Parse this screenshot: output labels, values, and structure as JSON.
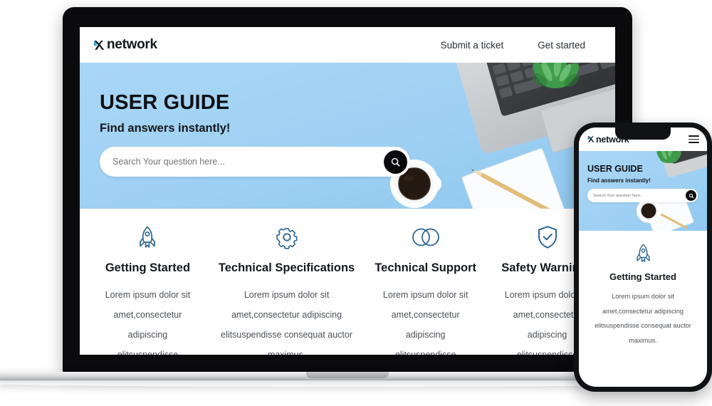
{
  "brand": {
    "name": "network",
    "mark_icon": "x-logo-icon",
    "accent_color": "#3aa0dd",
    "text_color": "#15181c"
  },
  "nav": {
    "links": [
      {
        "label": "Submit a ticket"
      },
      {
        "label": "Get started"
      }
    ],
    "mobile_menu_icon": "hamburger-menu-icon"
  },
  "hero": {
    "title": "USER GUIDE",
    "subtitle": "Find answers instantly!",
    "background_color": "#9ed0f3",
    "search": {
      "placeholder": "Search Your question here...",
      "value": "",
      "button_icon": "search-icon",
      "button_color": "#0b0b0d"
    }
  },
  "cards": [
    {
      "icon": "rocket-icon",
      "title": "Getting Started",
      "body": "Lorem ipsum dolor sit amet,consectetur adipiscing elitsuspendisse consequat auctor maximus."
    },
    {
      "icon": "gear-icon",
      "title": "Technical Specifications",
      "body": "Lorem ipsum dolor sit amet,consectetur adipiscing elitsuspendisse consequat auctor maximus."
    },
    {
      "icon": "venn-circles-icon",
      "title": "Technical Support",
      "body": "Lorem ipsum dolor sit amet,consectetur adipiscing elitsuspendisse consequat auctor maximus."
    },
    {
      "icon": "shield-check-icon",
      "title": "Safety Warnings",
      "body": "Lorem ipsum dolor sit amet,consectetur adipiscing elitsuspendisse consequat auctor maximus."
    }
  ],
  "mobile": {
    "card": {
      "icon": "rocket-icon",
      "title": "Getting Started",
      "body": "Lorem ipsum dolor sit amet,consectetur adipiscing elitsuspendisse consequat auctor maximus."
    }
  },
  "theme": {
    "icon_color": "#2c6791",
    "device_frame_color": "#0b0b0d",
    "page_background": "#ffffff"
  }
}
